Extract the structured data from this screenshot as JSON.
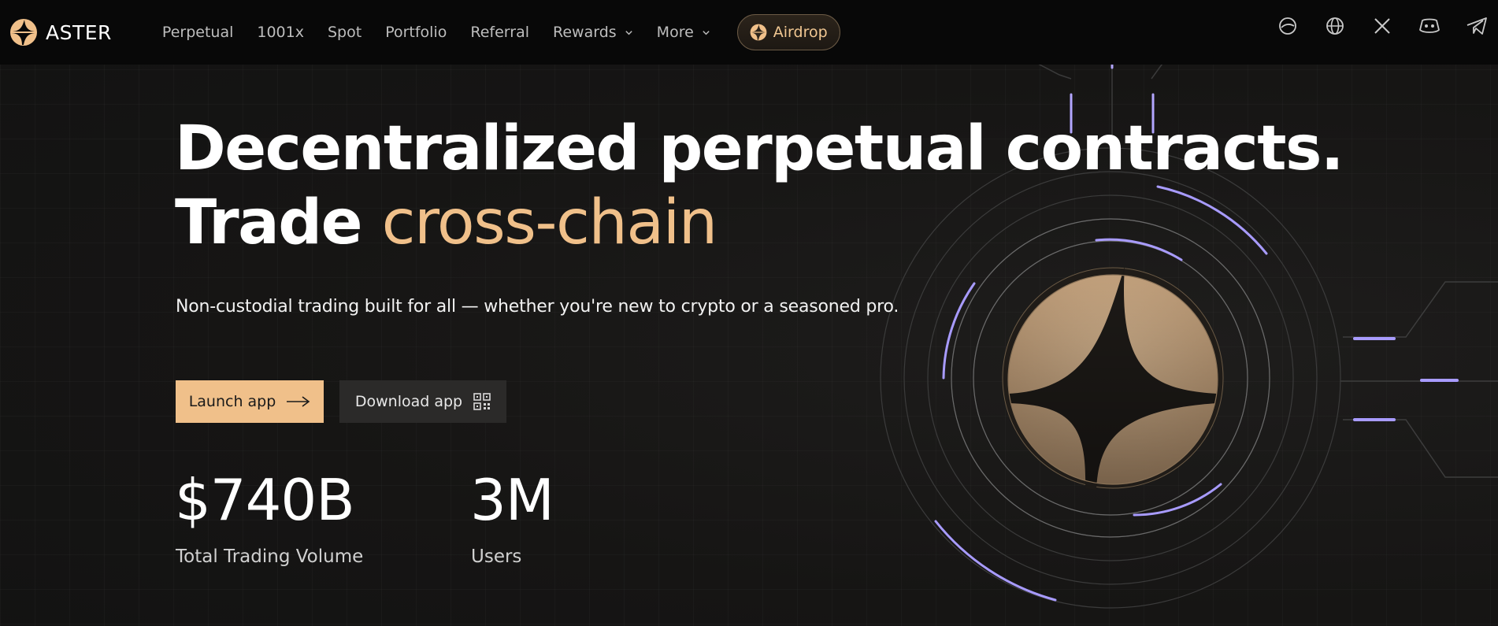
{
  "brand": {
    "name": "ASTER",
    "accent": "#f0c08a"
  },
  "nav": {
    "items": [
      {
        "label": "Perpetual",
        "dropdown": false
      },
      {
        "label": "1001x",
        "dropdown": false
      },
      {
        "label": "Spot",
        "dropdown": false
      },
      {
        "label": "Portfolio",
        "dropdown": false
      },
      {
        "label": "Referral",
        "dropdown": false
      },
      {
        "label": "Rewards",
        "dropdown": true
      },
      {
        "label": "More",
        "dropdown": true
      }
    ],
    "airdrop_label": "Airdrop"
  },
  "social": [
    "docs-icon",
    "globe-icon",
    "x-icon",
    "discord-icon",
    "telegram-icon"
  ],
  "hero": {
    "title_line1": "Decentralized perpetual contracts.",
    "title_line2_prefix": "Trade ",
    "title_line2_accent": "cross-chain",
    "subtitle": "Non-custodial trading built for all — whether you're new to crypto or a seasoned pro."
  },
  "buttons": {
    "launch": "Launch app",
    "download": "Download app"
  },
  "stats": [
    {
      "value": "$740B",
      "label": "Total Trading Volume"
    },
    {
      "value": "3M",
      "label": "Users"
    }
  ]
}
